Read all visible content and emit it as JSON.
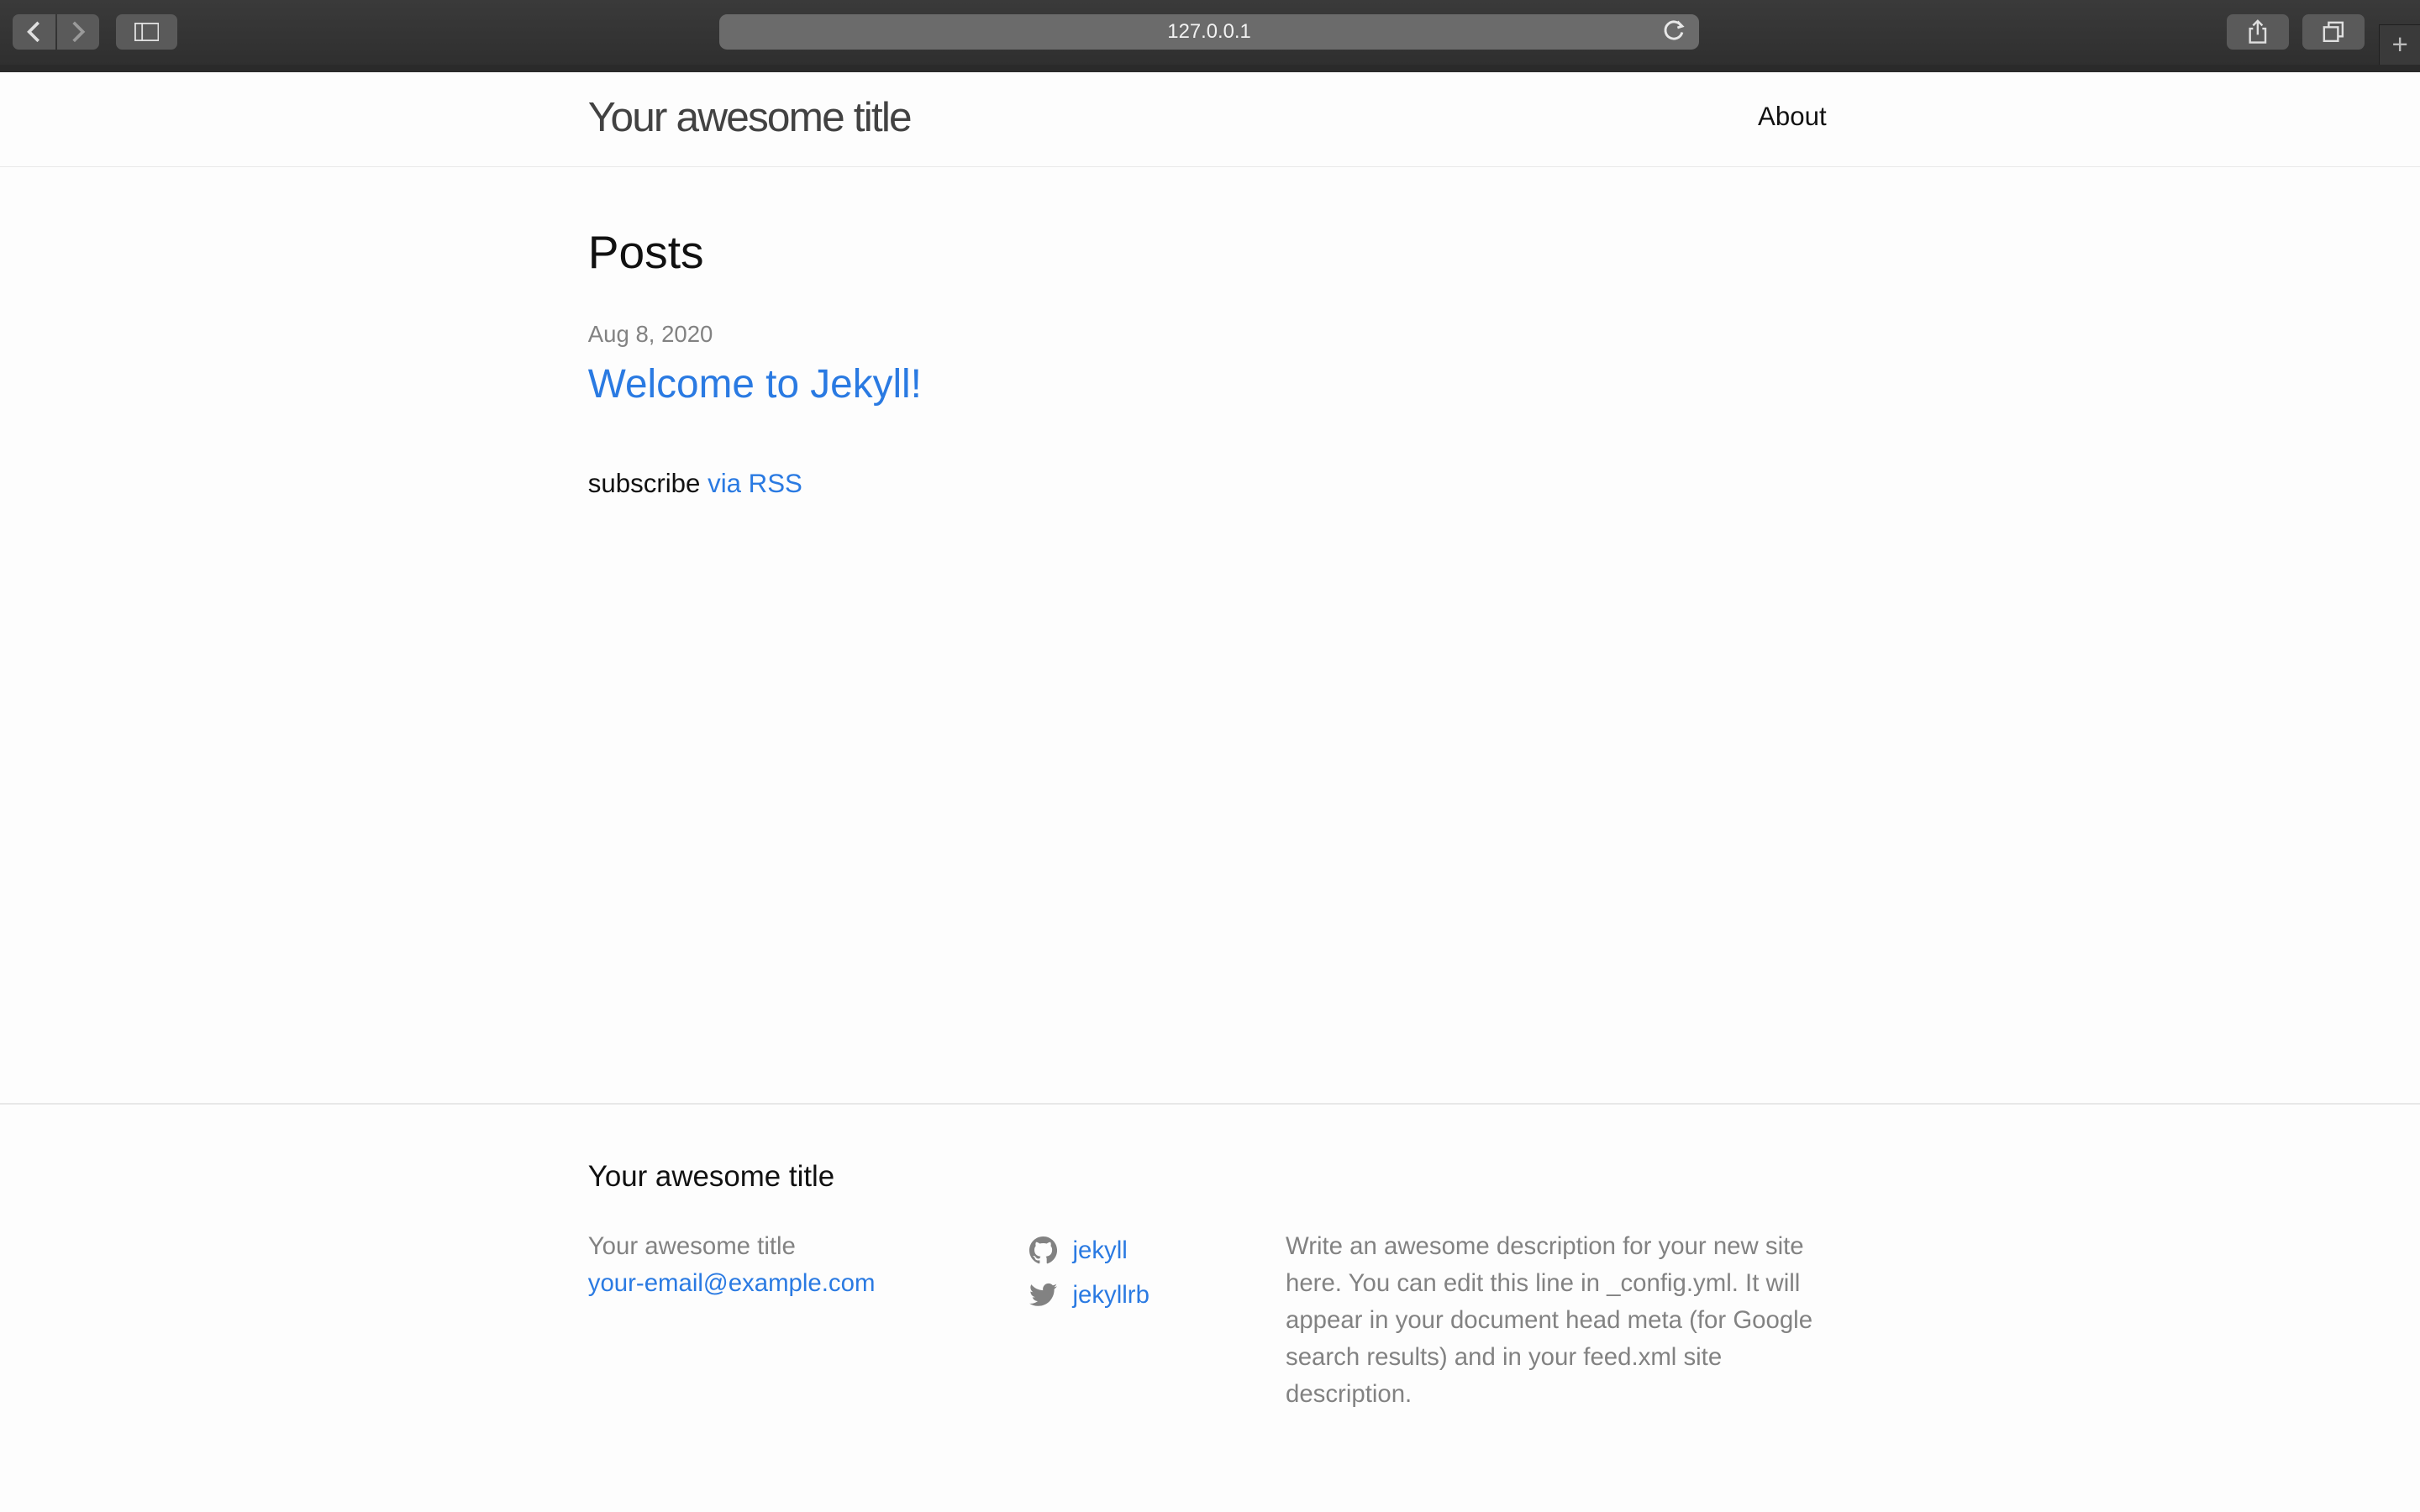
{
  "browser": {
    "url": "127.0.0.1",
    "new_tab": "+"
  },
  "header": {
    "site_title": "Your awesome title",
    "nav": [
      {
        "label": "About"
      }
    ]
  },
  "main": {
    "heading": "Posts",
    "posts": [
      {
        "date": "Aug 8, 2020",
        "title": "Welcome to Jekyll!"
      }
    ],
    "rss_prefix": "subscribe",
    "rss_link": "via RSS"
  },
  "footer": {
    "heading": "Your awesome title",
    "name": "Your awesome title",
    "email": "your-email@example.com",
    "social": [
      {
        "icon": "github-icon",
        "label": "jekyll"
      },
      {
        "icon": "twitter-icon",
        "label": "jekyllrb"
      }
    ],
    "description": "Write an awesome description for your new site here. You can edit this line in _config.yml. It will appear in your document head meta (for Google search results) and in your feed.xml site description."
  },
  "colors": {
    "link": "#2a7ae2",
    "muted": "#828282",
    "text": "#111111"
  }
}
